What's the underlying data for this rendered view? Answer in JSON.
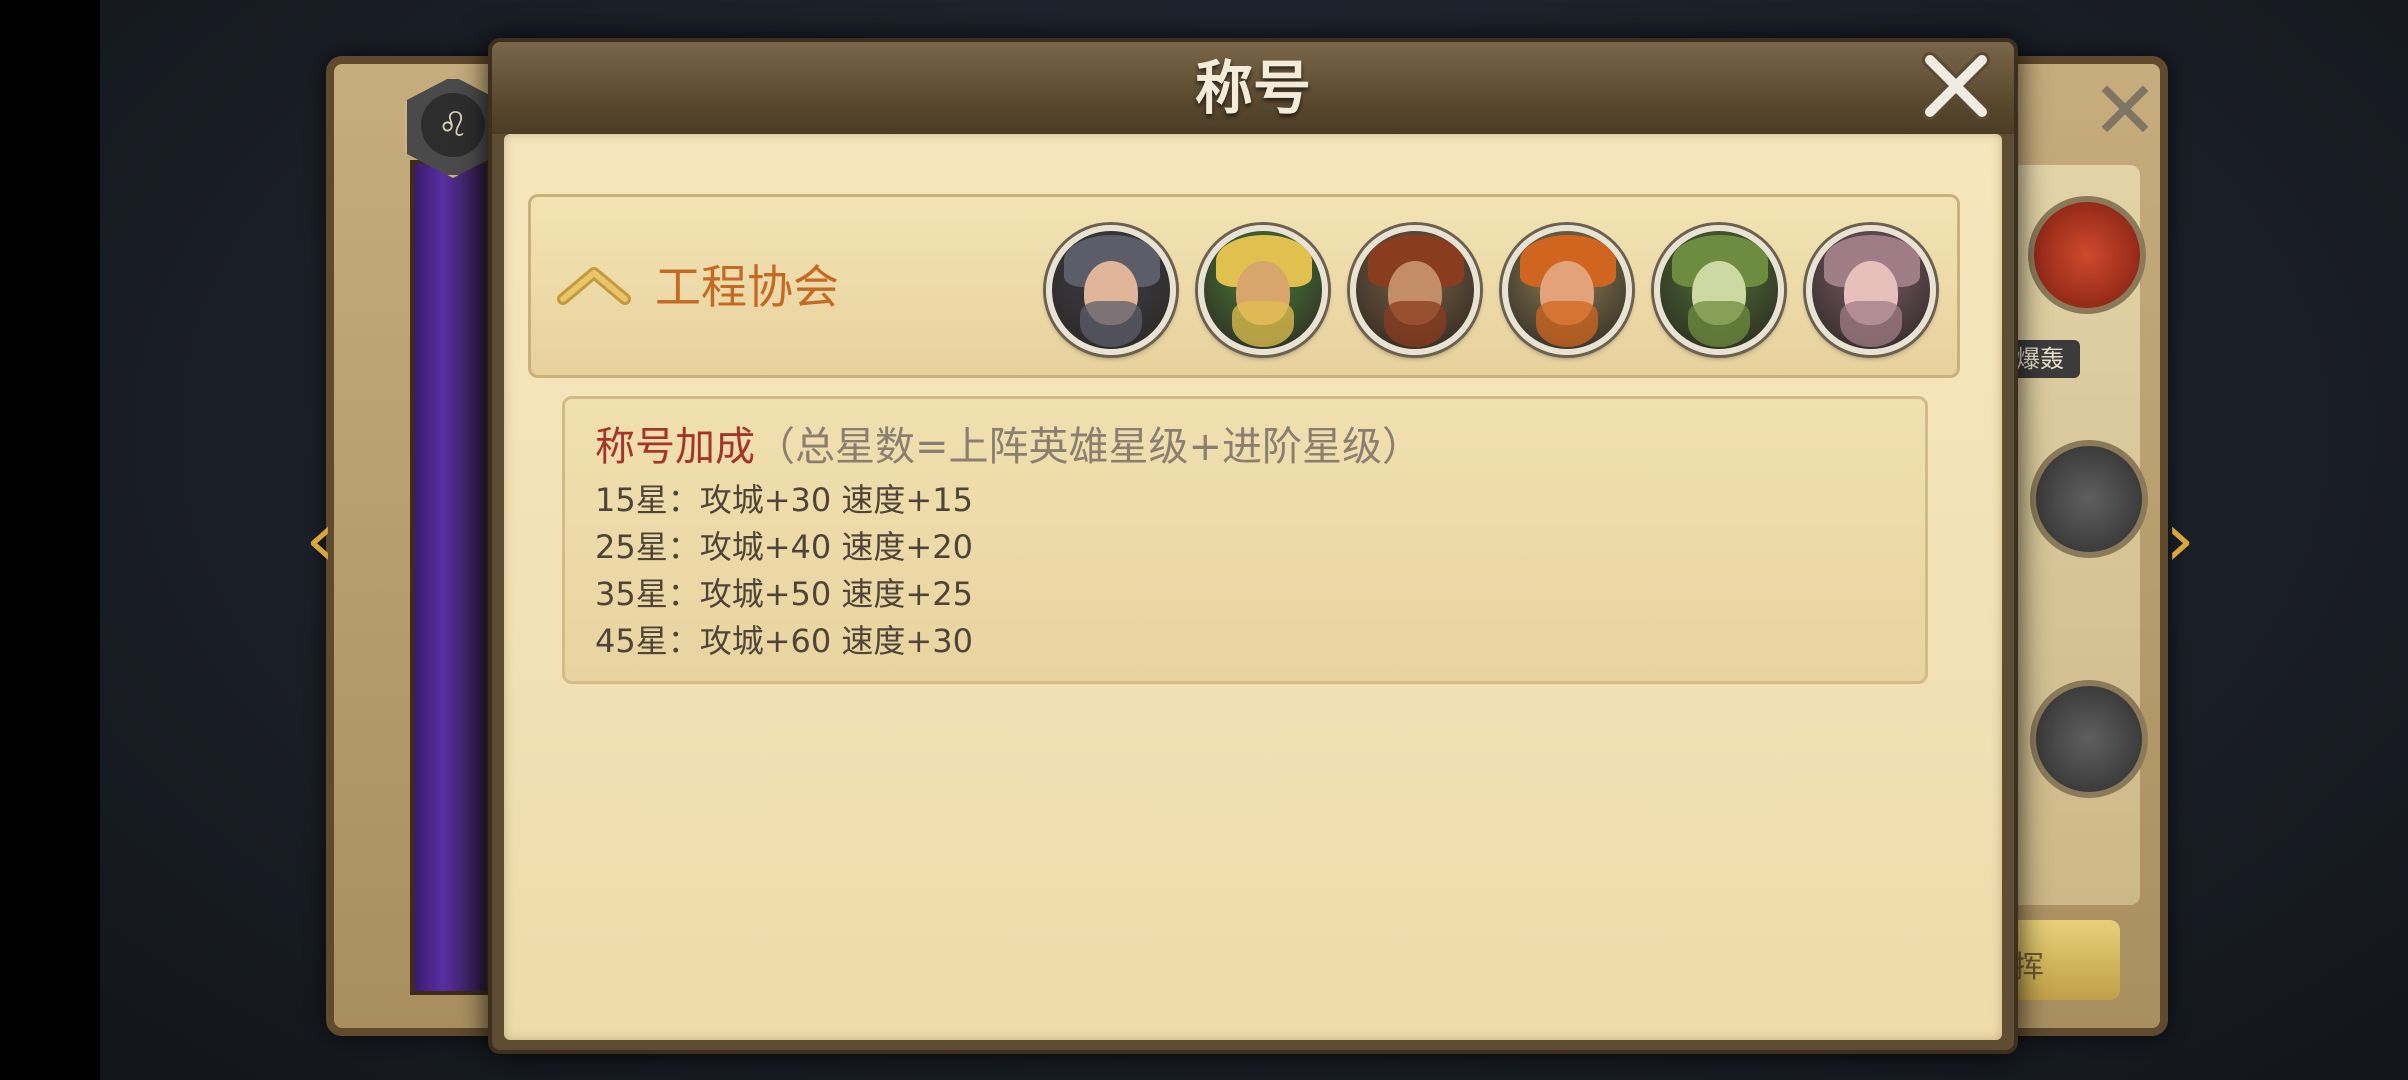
{
  "modal": {
    "title": "称号",
    "close_icon": "close-x-icon"
  },
  "guild": {
    "name": "工程协会",
    "toggle_icon": "chevron-up-icon",
    "heroes": [
      {
        "name": "hero-1",
        "palette": [
          "#3e3f49",
          "#e1b59a",
          "#5b5d69"
        ]
      },
      {
        "name": "hero-2",
        "palette": [
          "#4a7d3a",
          "#d8a56b",
          "#e2c04f"
        ]
      },
      {
        "name": "hero-3",
        "palette": [
          "#7a5f44",
          "#c48d6a",
          "#8a3c1f"
        ]
      },
      {
        "name": "hero-4",
        "palette": [
          "#8e7f55",
          "#e3a27a",
          "#d0651f"
        ]
      },
      {
        "name": "hero-5",
        "palette": [
          "#4d6f36",
          "#cdd9a3",
          "#6d8c3f"
        ]
      },
      {
        "name": "hero-6",
        "palette": [
          "#7a5c6a",
          "#e8c0bb",
          "#a07c86"
        ]
      }
    ]
  },
  "bonus": {
    "title": "称号加成",
    "note": "（总星数=上阵英雄星级+进阶星级）",
    "lines": [
      "15星：攻城+30  速度+15",
      "25星：攻城+40  速度+20",
      "35星：攻城+50  速度+25",
      "45星：攻城+60  速度+30"
    ]
  },
  "background": {
    "tag_label": "爆轰",
    "btn_fragment": "挥"
  },
  "colors": {
    "accent": "#c46a25",
    "title_red": "#a4352a",
    "panel": "#f2e2b6"
  }
}
